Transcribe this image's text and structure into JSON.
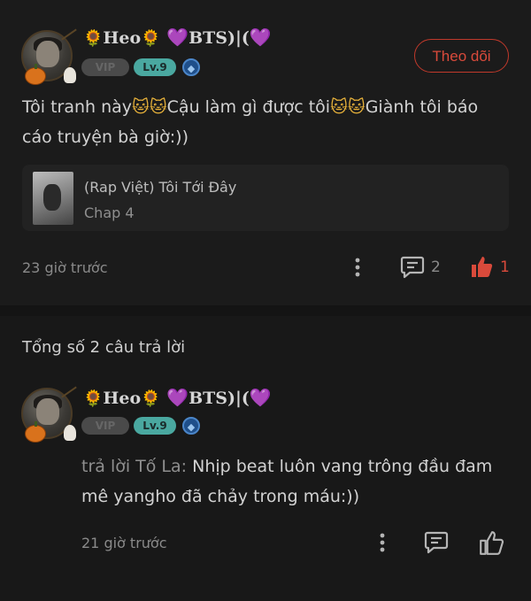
{
  "post": {
    "user": {
      "name_left": "Heo",
      "name_right": "BTS)|(",
      "vip_label": "VIP",
      "level_label": "Lv.9"
    },
    "follow_label": "Theo dõi",
    "text": {
      "part1": "Tôi tranh này",
      "part2": "Cậu làm gì được tôi",
      "part3": "Giành tôi báo",
      "line2": "cáo truyện bà giờ:))"
    },
    "story": {
      "title": "(Rap Việt) Tôi Tới Đây",
      "chapter": "Chap 4"
    },
    "time": "23 giờ trước",
    "comment_count": "2",
    "like_count": "1"
  },
  "replies_header": "Tổng số 2 câu trả lời",
  "reply": {
    "user": {
      "name_left": "Heo",
      "name_right": "BTS)|(",
      "vip_label": "VIP",
      "level_label": "Lv.9"
    },
    "prefix": "trả lời Tố La:",
    "text": " Nhịp beat luôn vang trông đầu đam mê yangho đã chảy trong máu:))",
    "time": "21 giờ trước"
  },
  "colors": {
    "background": "#181818",
    "accent_red": "#d94a3b",
    "level_badge": "#4aa8a0"
  }
}
